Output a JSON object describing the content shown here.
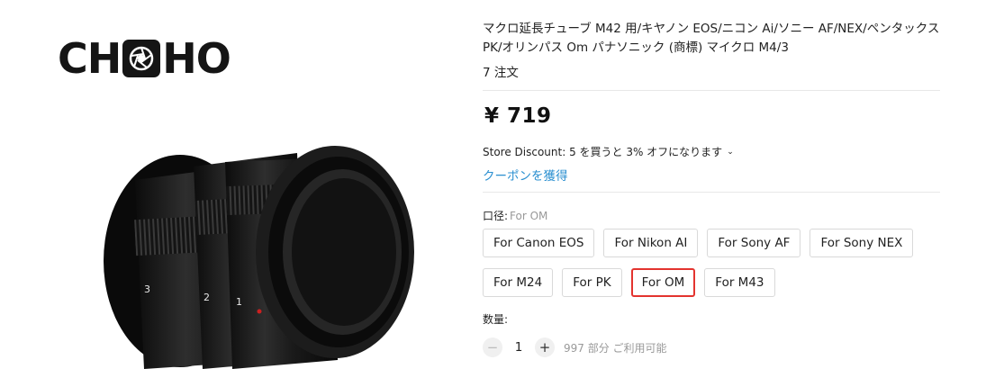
{
  "brand": {
    "name_left": "CH",
    "name_right": "HO",
    "logo_icon": "aperture-icon"
  },
  "product": {
    "title": "マクロ延長チューブ M42 用/キヤノン EOS/ニコン Ai/ソニー AF/NEX/ペンタックス PK/オリンパス Om パナソニック (商標) マイクロ M4/3",
    "orders": "7 注文",
    "price": "¥ 719",
    "store_discount": "Store Discount: 5 を買うと 3% オフになります",
    "coupon": "クーポンを獲得"
  },
  "option": {
    "label": "口径:",
    "selected": "For OM",
    "row1": [
      "For Canon EOS",
      "For Nikon AI",
      "For Sony AF",
      "For Sony NEX"
    ],
    "row2": [
      "For PK",
      "For OM",
      "For M43"
    ],
    "first_row2": "For M24"
  },
  "quantity": {
    "label": "数量:",
    "minus": "−",
    "value": "1",
    "plus": "+",
    "available": "997 部分 ご利用可能"
  },
  "lens_numbers": [
    "3",
    "2",
    "1"
  ],
  "colors": {
    "accent_red": "#e3342f",
    "link_blue": "#2a8fd0"
  }
}
